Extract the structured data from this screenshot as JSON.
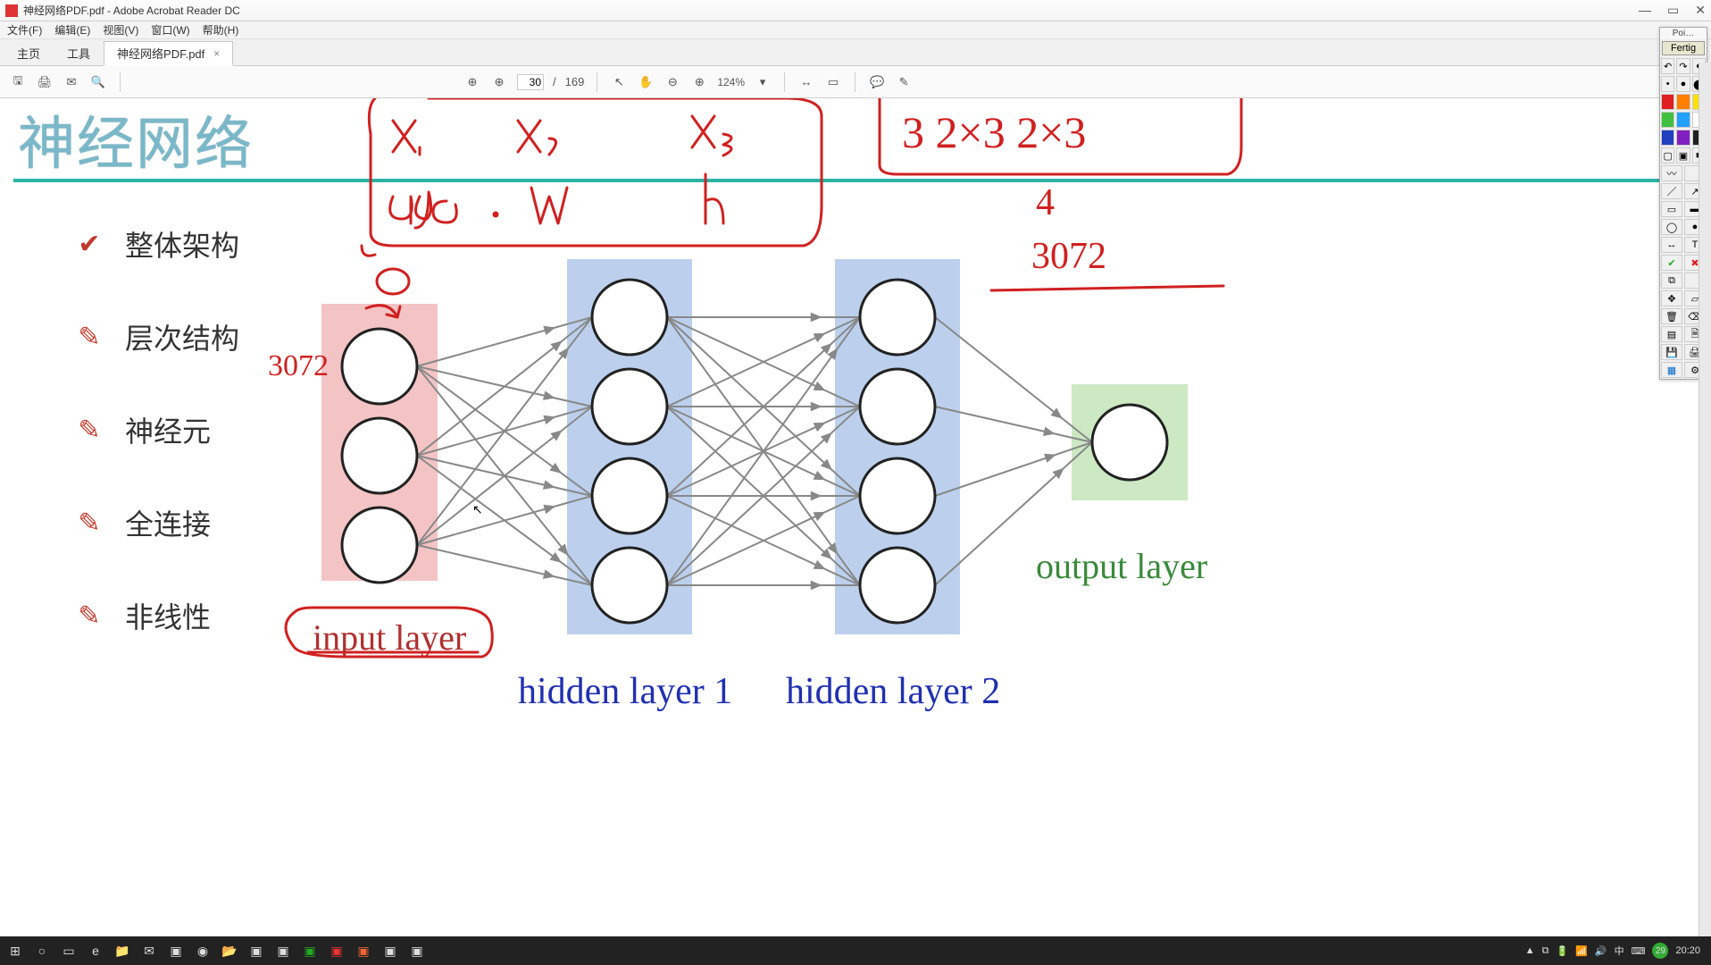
{
  "app": {
    "title": "神经网络PDF.pdf - Adobe Acrobat Reader DC"
  },
  "menu": {
    "file": "文件(F)",
    "edit": "编辑(E)",
    "view": "视图(V)",
    "window": "窗口(W)",
    "help": "帮助(H)"
  },
  "tabs": {
    "home": "主页",
    "tools": "工具",
    "doc": "神经网络PDF.pdf",
    "close": "×",
    "helpq": "?"
  },
  "toolbar": {
    "page_current": "30",
    "page_sep": "/",
    "page_total": "169",
    "zoom": "124%",
    "dropdown": "▾"
  },
  "pdf": {
    "heading": "神经网络",
    "bullets": [
      {
        "glyph": "✔",
        "text": "整体架构"
      },
      {
        "glyph": "✎",
        "text": "层次结构"
      },
      {
        "glyph": "✎",
        "text": "神经元"
      },
      {
        "glyph": "✎",
        "text": "全连接"
      },
      {
        "glyph": "✎",
        "text": "非线性"
      }
    ],
    "layers": {
      "input": "input layer",
      "h1": "hidden layer 1",
      "h2": "hidden layer 2",
      "out": "output layer"
    }
  },
  "annotations": {
    "box1": [
      "x₁",
      "x₂",
      "x₃",
      "age",
      ".",
      "W",
      "h"
    ],
    "box2": "3 2×3 2×3",
    "lines": [
      "4",
      "3072"
    ],
    "near_input": "3072",
    "circle_label": "input layer"
  },
  "pointofix": {
    "name": "Poi…",
    "done": "Fertig",
    "colors_row1": [
      "#e02020",
      "#ff8000",
      "#ffe000"
    ],
    "colors_row2": [
      "#40c040",
      "#20a0ff",
      "#ffffff"
    ],
    "colors_row3": [
      "#2040c0",
      "#8020c0",
      "#202020"
    ]
  },
  "taskbar": {
    "tray_lang": "中",
    "time": "20:20",
    "badge": "29"
  }
}
